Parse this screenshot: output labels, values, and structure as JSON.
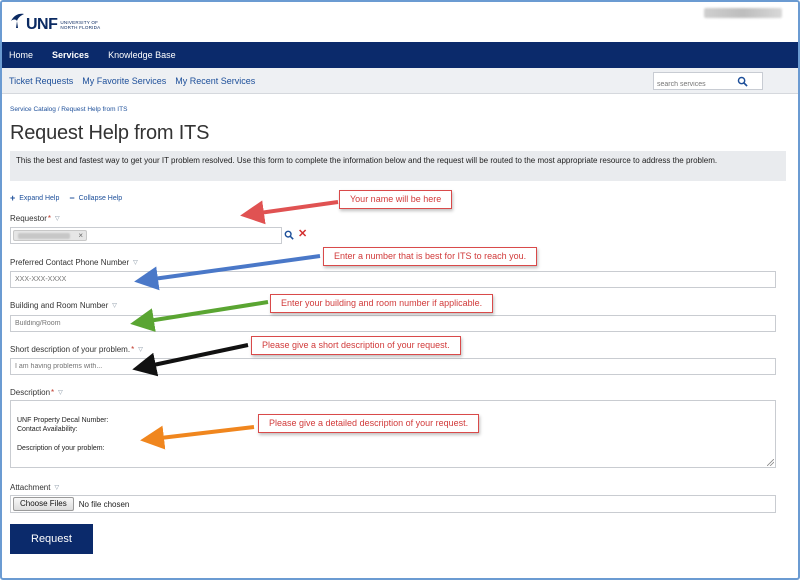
{
  "brand": {
    "logo_text": "UNF",
    "logo_subtext_line1": "University of",
    "logo_subtext_line2": "North Florida"
  },
  "main_nav": [
    {
      "label": "Home",
      "active": false
    },
    {
      "label": "Services",
      "active": true
    },
    {
      "label": "Knowledge Base",
      "active": false
    }
  ],
  "sub_nav": [
    {
      "label": "Ticket Requests"
    },
    {
      "label": "My Favorite Services"
    },
    {
      "label": "My Recent Services"
    }
  ],
  "search": {
    "placeholder": "search services"
  },
  "breadcrumb": "Service Catalog / Request Help from ITS",
  "page": {
    "title": "Request Help from ITS",
    "intro": "This the best and fastest way to get your IT problem resolved. Use this form to complete the information below and the request will be routed to the most appropriate resource to address the problem."
  },
  "help": {
    "expand_label": "Expand Help",
    "expand_glyph": "+",
    "collapse_label": "Collapse Help",
    "collapse_glyph": "−"
  },
  "form": {
    "requestor_label": "Requestor",
    "required_mark": "*",
    "label_toggle": "▽",
    "chip_remove": "×",
    "clear_glyph": "✕",
    "phone_label": "Preferred Contact Phone Number",
    "phone_placeholder": "XXX-XXX-XXXX",
    "room_label": "Building and Room Number",
    "room_placeholder": "Building/Room",
    "short_label": "Short description of your problem.",
    "short_placeholder": "I am having problems with...",
    "desc_label": "Description",
    "desc_value": "UNF Property Decal Number:\nContact Availability:\n\nDescription of your problem:",
    "attachment_label": "Attachment",
    "choose_files": "Choose Files",
    "no_file": "No file chosen",
    "submit_label": "Request"
  },
  "annotations": [
    {
      "text": "Your name will be here",
      "color": "#e05252"
    },
    {
      "text": "Enter a number that is best for ITS to reach you.",
      "color": "#4a78c8"
    },
    {
      "text": "Enter your building and room number if applicable.",
      "color": "#5aa532"
    },
    {
      "text": "Please give a short description of your request.",
      "color": "#111111"
    },
    {
      "text": "Please give a detailed description of your request.",
      "color": "#f0861e"
    }
  ],
  "colors": {
    "nav_bg": "#0b2a6b",
    "link": "#1d4f9a",
    "required": "#c0392b",
    "callout_text": "#d13a3a"
  }
}
